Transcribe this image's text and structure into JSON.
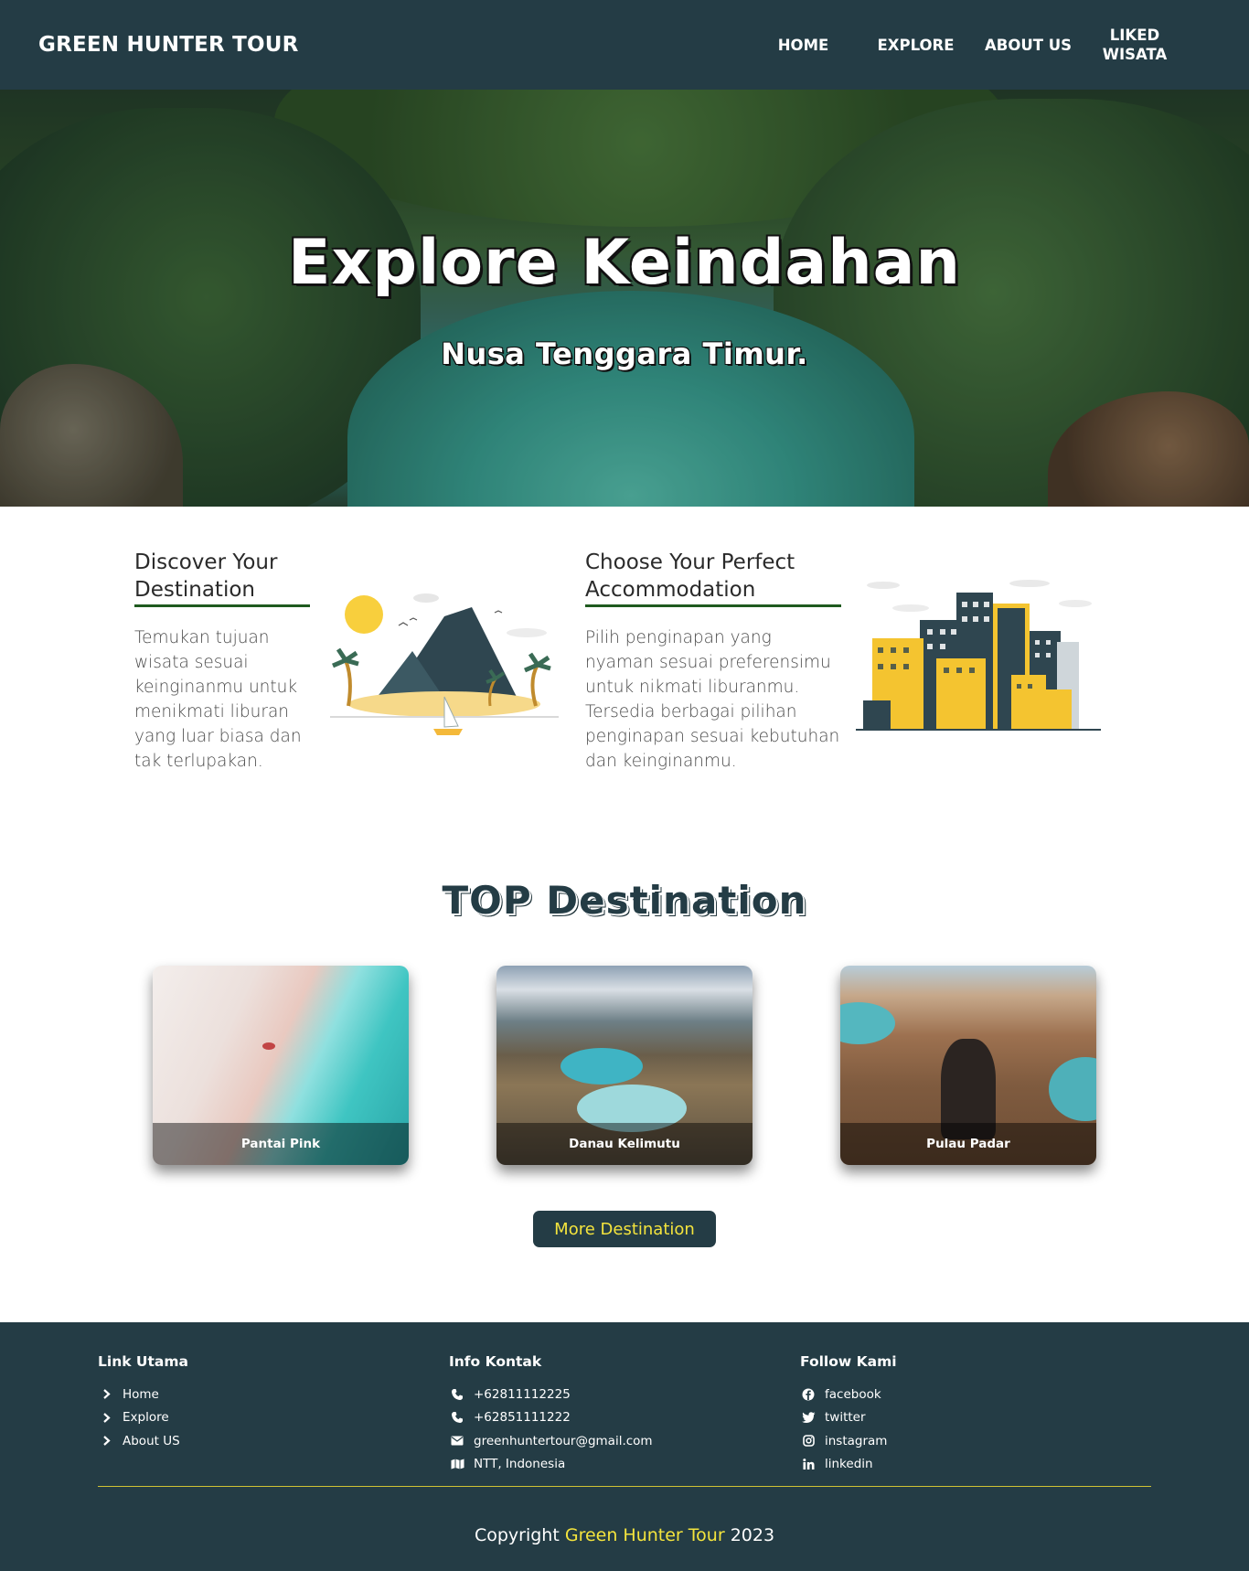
{
  "header": {
    "brand": "GREEN HUNTER TOUR",
    "nav": [
      {
        "label": "HOME"
      },
      {
        "label": "EXPLORE"
      },
      {
        "label": "ABOUT US"
      },
      {
        "label_line1": "LIKED",
        "label_line2": "WISATA"
      }
    ]
  },
  "hero": {
    "title": "Explore Keindahan",
    "subtitle": "Nusa Tenggara Timur."
  },
  "features": [
    {
      "title": "Discover Your Destination",
      "text": "Temukan tujuan wisata sesuai keinginanmu untuk menikmati liburan yang luar biasa dan tak terlupakan."
    },
    {
      "title": "Choose Your Perfect Accommodation",
      "text": "Pilih penginapan yang nyaman sesuai preferensimu untuk nikmati liburanmu. Tersedia berbagai pilihan penginapan sesuai kebutuhan dan keinginanmu."
    }
  ],
  "top_destination": {
    "title": "TOP Destination",
    "cards": [
      {
        "label": "Pantai Pink"
      },
      {
        "label": "Danau Kelimutu"
      },
      {
        "label": "Pulau Padar"
      }
    ],
    "more_button": "More Destination"
  },
  "footer": {
    "col1": {
      "title": "Link Utama",
      "items": [
        {
          "label": "Home",
          "icon": "chevron-right-icon"
        },
        {
          "label": "Explore",
          "icon": "chevron-right-icon"
        },
        {
          "label": "About US",
          "icon": "chevron-right-icon"
        }
      ]
    },
    "col2": {
      "title": "Info Kontak",
      "items": [
        {
          "label": "+62811112225",
          "icon": "phone-icon"
        },
        {
          "label": "+62851111222",
          "icon": "phone-icon"
        },
        {
          "label": "greenhuntertour@gmail.com",
          "icon": "envelope-icon"
        },
        {
          "label": "NTT, Indonesia",
          "icon": "map-icon"
        }
      ]
    },
    "col3": {
      "title": "Follow Kami",
      "items": [
        {
          "label": "facebook",
          "icon": "facebook-icon"
        },
        {
          "label": "twitter",
          "icon": "twitter-icon"
        },
        {
          "label": "instagram",
          "icon": "instagram-icon"
        },
        {
          "label": "linkedin",
          "icon": "linkedin-icon"
        }
      ]
    },
    "copyright_prefix": "Copyright",
    "copyright_brand": "Green Hunter Tour",
    "copyright_year": "2023"
  },
  "colors": {
    "primary": "#243c45",
    "accent": "#f4e43d",
    "underline": "#1f5a1f"
  }
}
